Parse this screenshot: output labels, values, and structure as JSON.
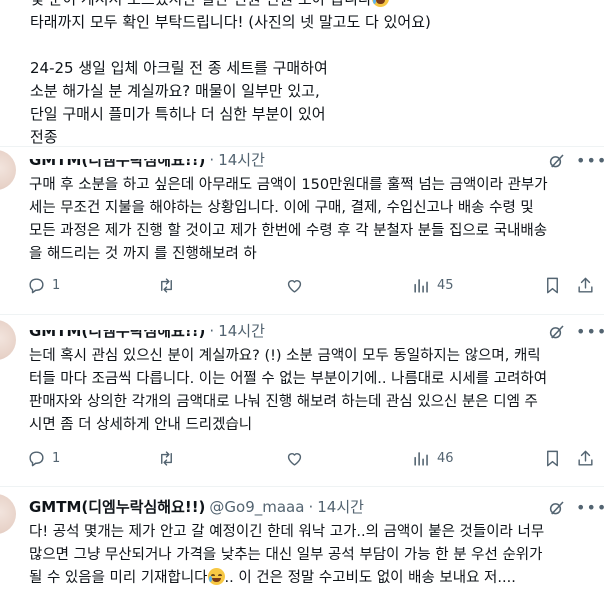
{
  "context": {
    "lines_a": [
      "몇 분이 계셔서 모르셨지만 일단 인원 인원 모아 봅니다",
      "타래까지 모두 확인 부탁드립니다! (사진의 넷 말고도 다 있어요)"
    ],
    "lines_b": [
      "24-25 생일 입체 아크릴 전 종 세트를 구매하여",
      "소분 해가실 분 계실까요? 매물이 일부만 있고,",
      "단일 구매시 플미가 특히나 더 심한 부분이 있어",
      "전종"
    ]
  },
  "posts": [
    {
      "name": "GMTM(디엠누락심해요!!)",
      "handle": "",
      "dot": "·",
      "time": "14시간",
      "lines": [
        "구매 후 소분을 하고 싶은데 아무래도 금액이 150만원대를 훌쩍 넘는 금액이라 관부가",
        "세는 무조건 지불을 해야하는 상황입니다. 이에 구매, 결제, 수입신고나 배송 수령 및",
        "모든 과정은 제가 진행 할 것이고 제가 한번에 수령 후 각 분철자 분들 집으로 국내배송",
        "을 해드리는 것 까지 를 진행해보려 하"
      ],
      "replies": "1",
      "reposts": "",
      "likes": "",
      "views": "45"
    },
    {
      "name": "GMTM(디엠누락심해요!!)",
      "handle": "",
      "dot": "·",
      "time": "14시간",
      "lines": [
        "는데 혹시 관심 있으신 분이 계실까요? (!) 소분 금액이 모두 동일하지는 않으며, 캐릭",
        "터들 마다 조금씩 다릅니다. 이는 어쩔 수 없는 부분이기에.. 나름대로 시세를 고려하여",
        "판매자와 상의한 각개의 금액대로 나눠 진행 해보려 하는데 관심 있으신 분은 디엠 주",
        "시면 좀 더 상세하게 안내 드리겠습니"
      ],
      "replies": "1",
      "reposts": "",
      "likes": "",
      "views": "46"
    },
    {
      "name": "GMTM(디엠누락심해요!!)",
      "handle": "@Go9_maaa",
      "dot": "·",
      "time": "14시간",
      "lines": [
        "다! 공석 몇개는 제가 안고 갈 예정이긴 한데 워낙 고가..의 금액이 붙은 것들이라 너무",
        "많으면 그냥 무산되거나 가격을 낮추는 대신 일부 공석 부담이 가능 한 분 우선 순위가",
        "될 수 있음을 미리 기재합니다",
        ".. 이 건은 정말 수고비도 없이 배송 보내요 저...."
      ]
    }
  ],
  "icons": {
    "reply": "reply-icon",
    "repost": "repost-icon",
    "like": "heart-icon",
    "views": "views-icon",
    "bookmark": "bookmark-icon",
    "share": "share-icon",
    "grok": "grok-icon",
    "more": "more-icon"
  },
  "colors": {
    "text": "#0f1419",
    "secondary": "#536471",
    "divider": "#eff3f4"
  }
}
